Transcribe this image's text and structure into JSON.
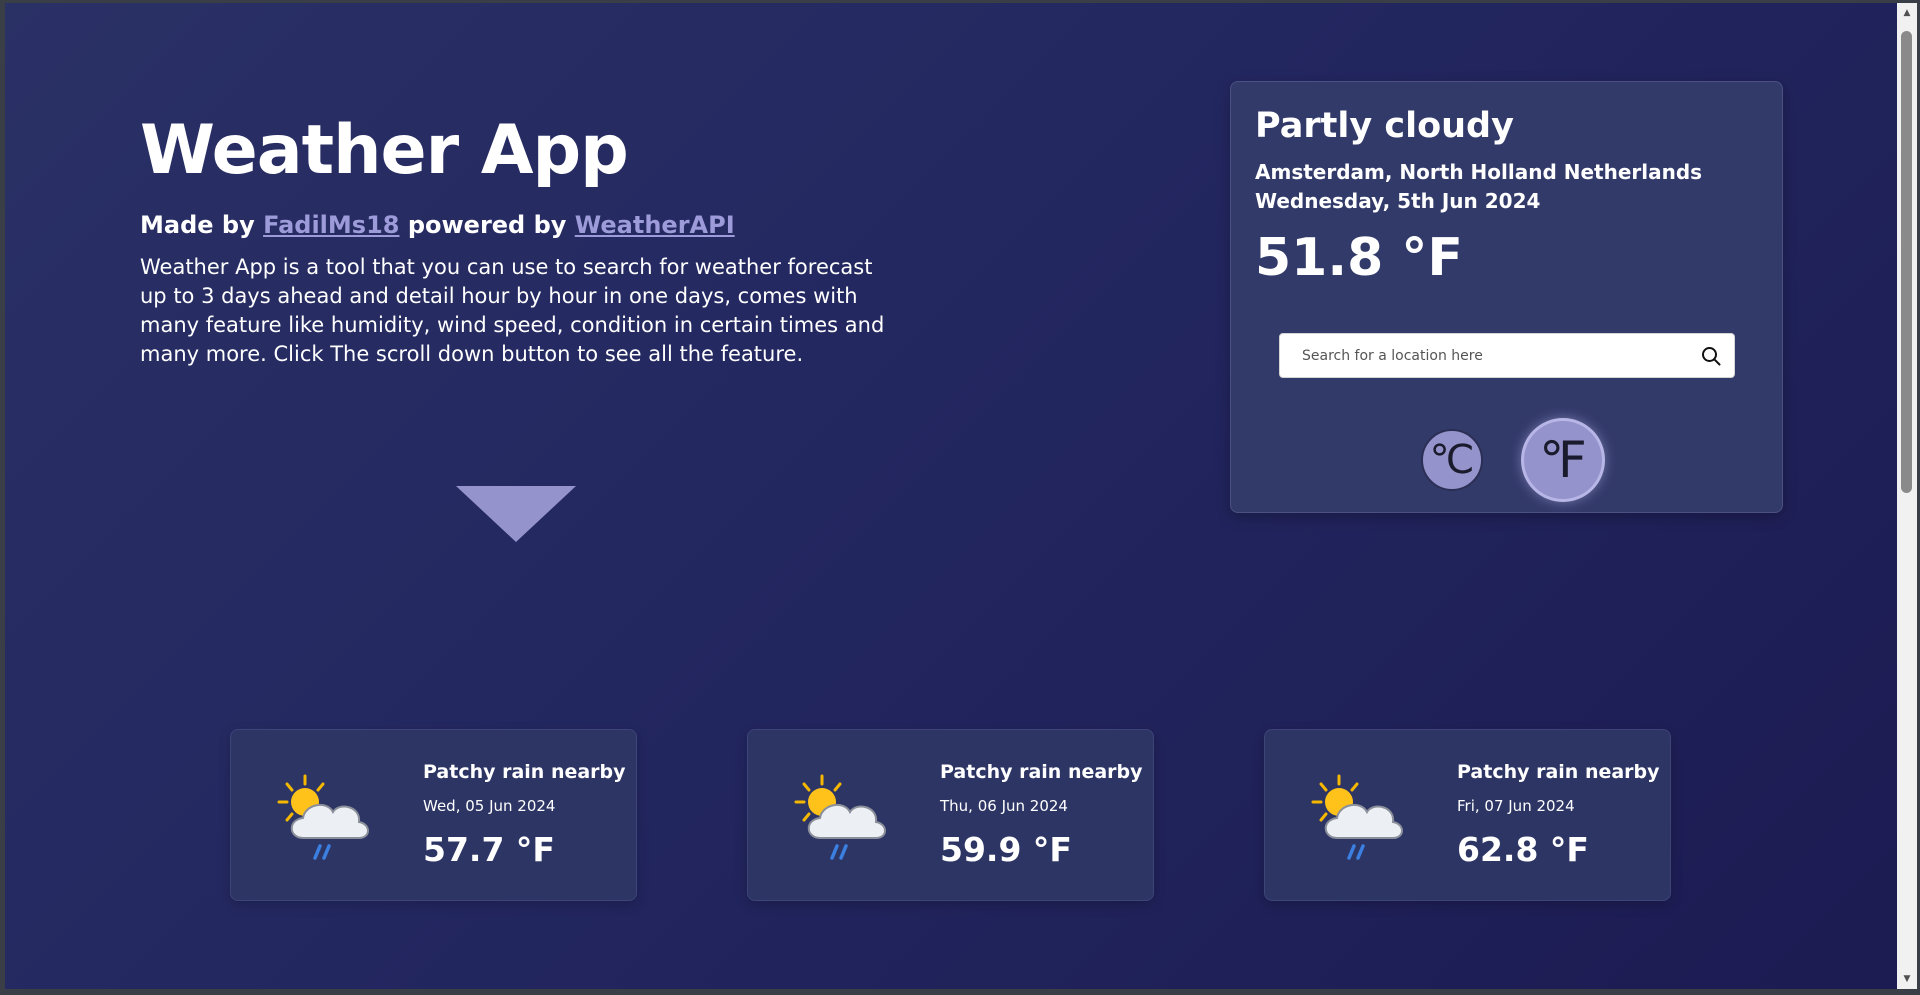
{
  "hero": {
    "title": "Weather App",
    "made_by_prefix": "Made by ",
    "author_link": "FadilMs18",
    "powered_by_text": " powered by ",
    "api_link": "WeatherAPI",
    "description": "Weather App is a tool that you can use to search for weather forecast up to 3 days ahead and detail hour by hour in one days, comes with many feature like humidity, wind speed, condition in certain times and many more. Click The scroll down button to see all the feature."
  },
  "current": {
    "condition": "Partly cloudy",
    "location": "Amsterdam, North Holland Netherlands",
    "date": "Wednesday, 5th Jun 2024",
    "temperature": "51.8 °F",
    "search_placeholder": "Search for a location here",
    "unit_celsius": "℃",
    "unit_fahrenheit": "℉",
    "selected_unit": "fahrenheit"
  },
  "forecast": [
    {
      "icon": "patchy-rain-icon",
      "condition": "Patchy rain nearby",
      "date": "Wed, 05 Jun 2024",
      "temperature": "57.7 °F"
    },
    {
      "icon": "patchy-rain-icon",
      "condition": "Patchy rain nearby",
      "date": "Thu, 06 Jun 2024",
      "temperature": "59.9 °F"
    },
    {
      "icon": "patchy-rain-icon",
      "condition": "Patchy rain nearby",
      "date": "Fri, 07 Jun 2024",
      "temperature": "62.8 °F"
    }
  ],
  "colors": {
    "background_start": "#2a3165",
    "background_end": "#1c1b52",
    "card": "#323a6a",
    "accent": "#9593cc",
    "link": "#9d9bd9"
  }
}
